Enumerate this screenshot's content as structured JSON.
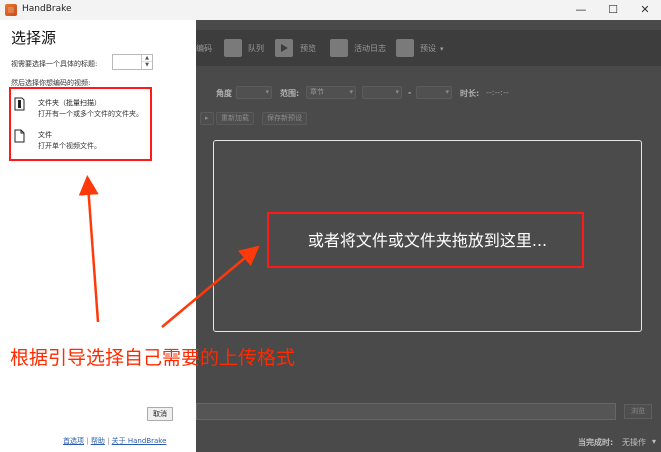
{
  "window": {
    "title": "HandBrake",
    "minimize": "—",
    "maximize": "☐",
    "close": "✕"
  },
  "toolbar": {
    "items": [
      "编码",
      "队列",
      "预览",
      "活动日志",
      "预设"
    ]
  },
  "controls": {
    "angle_label": "角度",
    "range_label": "范围:",
    "range_value": "章节",
    "dash": "-",
    "duration_label": "时长:",
    "duration_value": "--:--:--",
    "reload_button": "重新加载",
    "save_preset_button": "保存新预设"
  },
  "dropzone": {
    "text": "或者将文件或文件夹拖放到这里..."
  },
  "bottom": {
    "browse_button": "浏览",
    "when_done_label": "当完成时:",
    "when_done_value": "无操作"
  },
  "source_panel": {
    "title": "选择源",
    "title_prompt": "视需要选择一个具体的标题:",
    "then_prompt": "然后选择你想编码的视频:",
    "folder_option": {
      "title": "文件夹（批量扫描）",
      "subtitle": "打开有一个或多个文件的文件夹。"
    },
    "file_option": {
      "title": "文件",
      "subtitle": "打开单个视频文件。"
    },
    "cancel_button": "取消",
    "links": [
      "首选项",
      "帮助",
      "关于 HandBrake"
    ],
    "link_separator": "|"
  },
  "annotation": {
    "caption": "根据引导选择自己需要的上传格式",
    "color": "#ff2a00"
  }
}
